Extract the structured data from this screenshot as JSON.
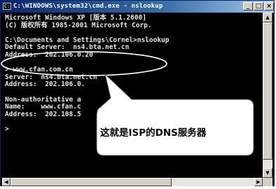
{
  "window": {
    "title": "C:\\WINDOWS\\system32\\cmd.exe - nslookup",
    "controls": {
      "minimize": "_",
      "maximize": "□",
      "close": "×"
    }
  },
  "console": {
    "lines": [
      "Microsoft Windows XP [版本 5.1.2600]",
      "(C) 版权所有 1985-2001 Microsoft Corp.",
      "",
      "C:\\Documents and Settings\\Cornel>nslookup",
      "Default Server:  ns4.bta.net.cn",
      "Address:  202.106.0.20",
      "",
      "> www.cfan.com.cn",
      "Server:  ns4.bta.net.cn",
      "Address:  202.106.0.",
      "",
      "Non-authoritative a",
      "Name:    www.cfan.c",
      "Address:  202.108.5",
      "",
      ">"
    ]
  },
  "annotation": {
    "callout_text": "这就是ISP的DNS服务器",
    "highlight_color": "#ffffff",
    "callout_fill": "#ffffff"
  },
  "icons": {
    "app": "cmd-icon",
    "up": "▲",
    "down": "▼",
    "left": "◀",
    "right": "▶"
  }
}
